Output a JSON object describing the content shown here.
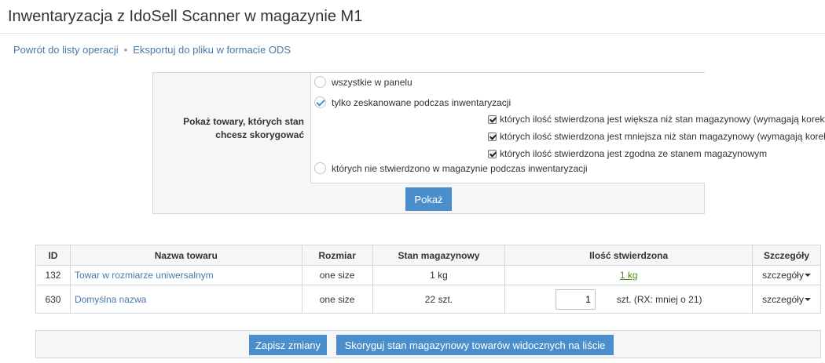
{
  "header": {
    "title": "Inwentaryzacja z IdoSell Scanner w magazynie M1"
  },
  "breadcrumbs": {
    "back_link": "Powrót do listy operacji",
    "separator": "•",
    "export_link": "Eksportuj do pliku w formacie ODS"
  },
  "filter": {
    "label": "Pokaż towary, których stan chcesz skorygować",
    "options": {
      "all": "wszystkie w panelu",
      "scanned": "tylko zeskanowane podczas inwentaryzacji",
      "greater": "których ilość stwierdzona jest większa niż stan magazynowy (wymagają korekty PX)",
      "smaller": "których ilość stwierdzona jest mniejsza niż stan magazynowy (wymagają korekty RX)",
      "equal": "których ilość stwierdzona jest zgodna ze stanem magazynowym",
      "not_found": "których nie stwierdzono w magazynie podczas inwentaryzacji"
    },
    "selected": "scanned",
    "checked": [
      "greater",
      "smaller",
      "equal"
    ],
    "show_button": "Pokaż"
  },
  "table": {
    "columns": [
      "ID",
      "Nazwa towaru",
      "Rozmiar",
      "Stan magazynowy",
      "Ilość stwierdzona",
      "Szczegóły"
    ],
    "rows": [
      {
        "id": "132",
        "name": "Towar w rozmiarze uniwersalnym",
        "size": "one size",
        "stock": "1 kg",
        "qty": "1 kg",
        "details": "szczegóły"
      },
      {
        "id": "630",
        "name": "Domyślna nazwa",
        "size": "one size",
        "stock": "22 szt.",
        "qty_value": "1",
        "qty_note": "szt. (RX: mniej o 21)",
        "details": "szczegóły"
      }
    ]
  },
  "actions": {
    "save": "Zapisz zmiany",
    "correct": "Skoryguj stan magazynowy towarów widocznych na liście"
  },
  "colors": {
    "accent": "#4a8ecb",
    "link": "#4a78a8",
    "qty_link": "#4f8a1e",
    "panel_bg": "#f4f6f8",
    "border": "#d3d8dd"
  }
}
